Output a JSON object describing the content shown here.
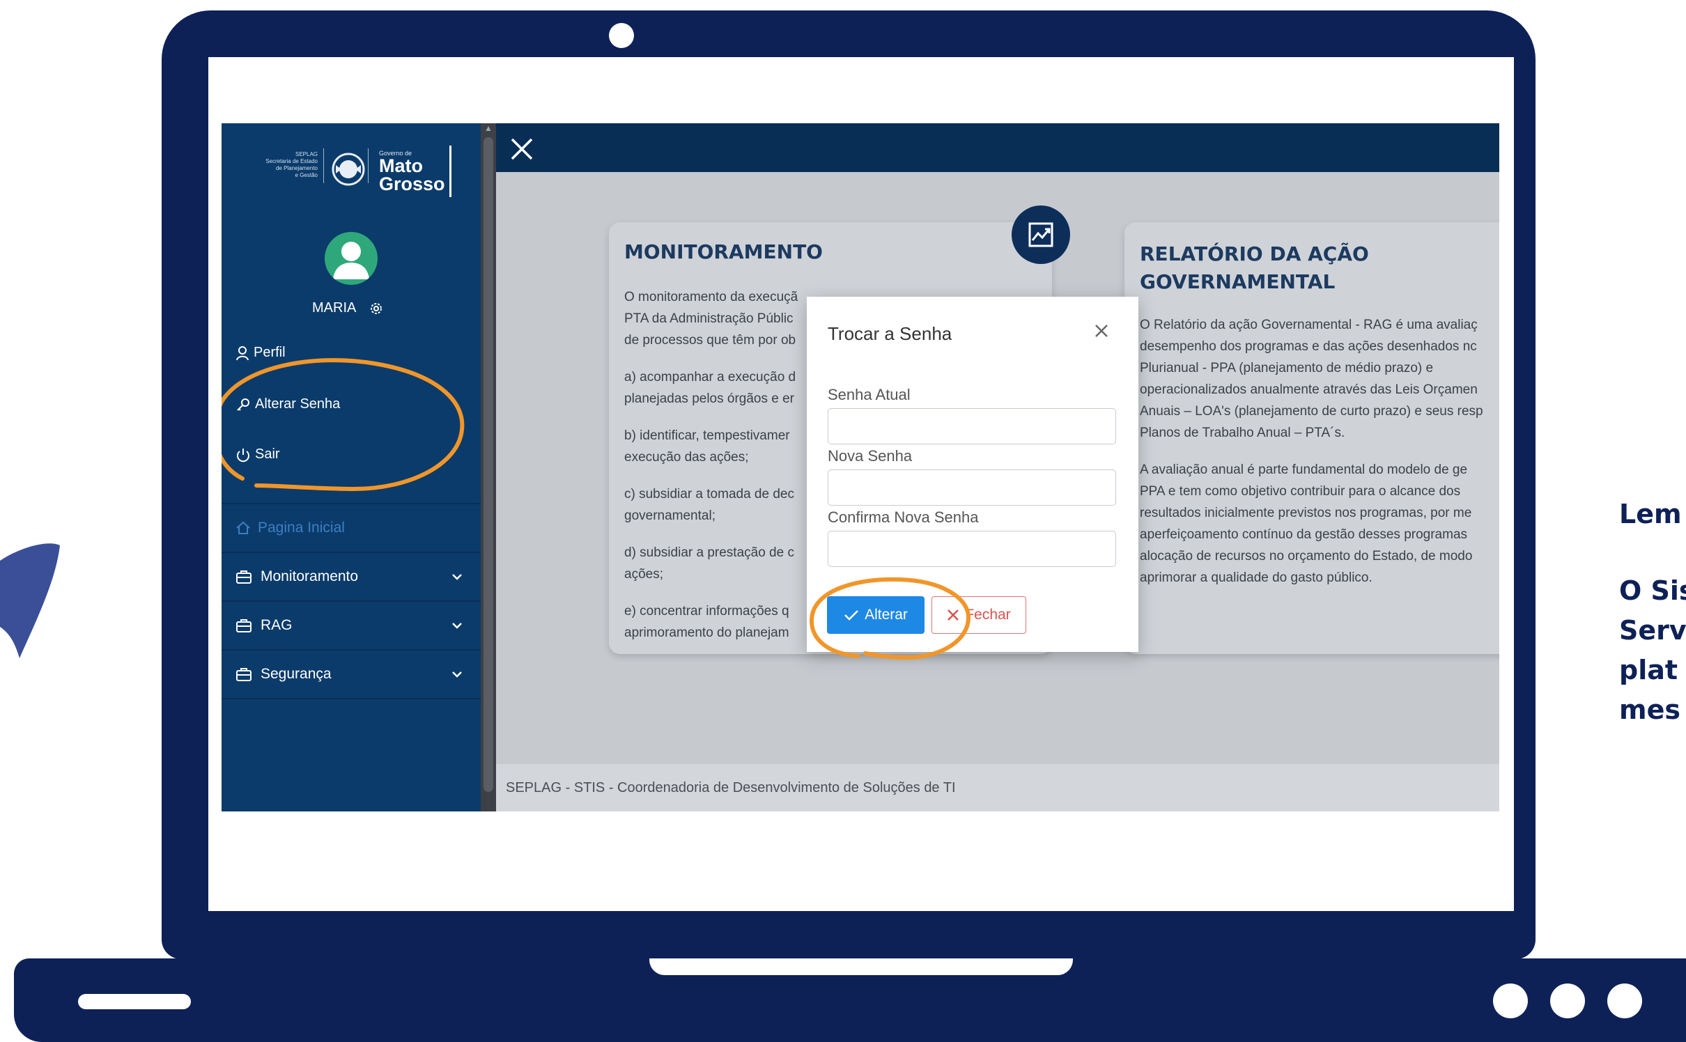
{
  "sidebar": {
    "logo": {
      "org_small": "SEPLAG",
      "org_lines": [
        "Secretaria de Estado",
        "de Planejamento",
        "e Gestão"
      ],
      "gov_small": "Governo de",
      "state_line1": "Mato",
      "state_line2": "Grosso"
    },
    "user_name": "MARIA",
    "menu": {
      "perfil": "Perfil",
      "alterar_senha": "Alterar Senha",
      "sair": "Sair",
      "pagina_inicial": "Pagina Inicial",
      "monitoramento": "Monitoramento",
      "rag": "RAG",
      "seguranca": "Segurança"
    }
  },
  "cards": {
    "monitoramento": {
      "title": "MONITORAMENTO",
      "lines": [
        "O monitoramento da execuçã",
        "PTA da Administração Públic",
        "de processos que têm por ob",
        "a) acompanhar a execução d",
        "planejadas pelos órgãos e er",
        "b) identificar, tempestivamer",
        "execução das ações;",
        "c) subsidiar a tomada de dec",
        "governamental;",
        "d) subsidiar a prestação de c",
        "ações;",
        "e) concentrar informações q",
        "aprimoramento do planejam"
      ]
    },
    "rag": {
      "title_line1": "RELATÓRIO DA AÇÃO",
      "title_line2": "GOVERNAMENTAL",
      "lines": [
        "O Relatório da ação Governamental - RAG é uma avaliaç",
        "desempenho dos programas e das ações desenhados nc",
        "Plurianual - PPA (planejamento de médio prazo) e",
        "operacionalizados anualmente através das Leis Orçamen",
        "Anuais – LOA's (planejamento de curto prazo) e seus resp",
        "Planos de Trabalho Anual – PTA´s.",
        "A avaliação anual é parte fundamental do modelo de ge",
        "PPA e tem como objetivo contribuir para o alcance dos",
        "resultados inicialmente previstos nos programas, por me",
        "aperfeiçoamento contínuo da gestão desses programas",
        "alocação de recursos no orçamento do Estado, de modo",
        "aprimorar a qualidade do gasto público."
      ]
    }
  },
  "modal": {
    "title": "Trocar a Senha",
    "senha_atual_label": "Senha Atual",
    "nova_senha_label": "Nova Senha",
    "confirma_label": "Confirma Nova Senha",
    "alterar_label": "Alterar",
    "fechar_label": "Fechar"
  },
  "footer": {
    "text": "SEPLAG - STIS - Coordenadoria de Desenvolvimento de Soluções de TI"
  },
  "side_text": {
    "lines": [
      "Lem",
      "O Sis",
      "Serv",
      "plat",
      "mes"
    ]
  },
  "colors": {
    "laptop": "#0e2157",
    "sidebar": "#0b3b6a",
    "highlight": "#f0962a",
    "primary_button": "#1e88e5",
    "danger": "#d9534f"
  }
}
